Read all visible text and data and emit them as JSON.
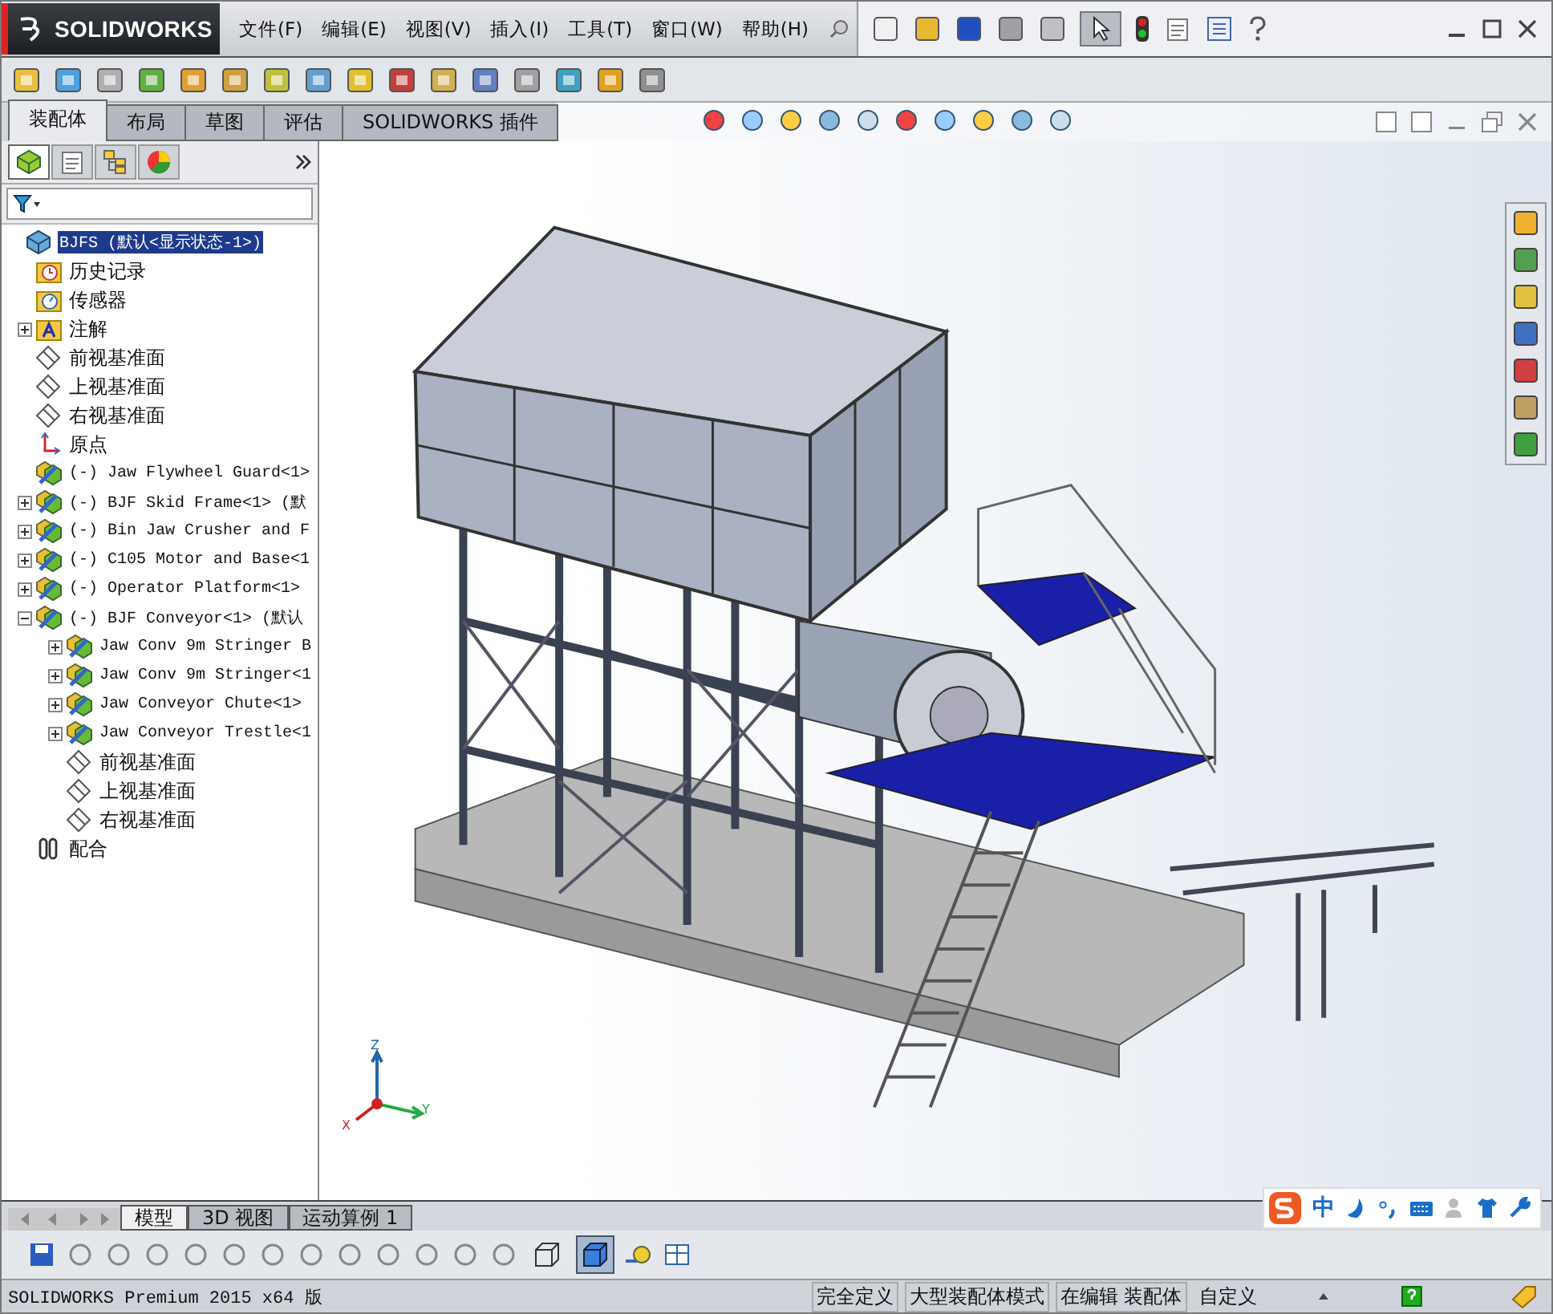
{
  "app": {
    "logo": "SOLIDWORKS"
  },
  "menu": [
    "文件(F)",
    "编辑(E)",
    "视图(V)",
    "插入(I)",
    "工具(T)",
    "窗口(W)",
    "帮助(H)"
  ],
  "select_tool": {
    "selected": true
  },
  "command_tabs": [
    {
      "label": "装配体",
      "selected": true
    },
    {
      "label": "布局",
      "selected": false
    },
    {
      "label": "草图",
      "selected": false
    },
    {
      "label": "评估",
      "selected": false
    },
    {
      "label": "SOLIDWORKS 插件",
      "selected": false
    }
  ],
  "panel_tabs": [
    {
      "kind": "features",
      "selected": true
    },
    {
      "kind": "properties",
      "selected": false
    },
    {
      "kind": "configurations",
      "selected": false
    },
    {
      "kind": "appearance",
      "selected": false
    }
  ],
  "feature_tree": [
    {
      "kind": "assembly",
      "label": "BJFS  (默认<显示状态-1>)",
      "selected": true,
      "children": [
        {
          "kind": "history",
          "label": "历史记录",
          "selected": false
        },
        {
          "kind": "sensor",
          "label": "传感器",
          "selected": false
        },
        {
          "kind": "annotation",
          "label": "注解",
          "selected": false,
          "expanded": false
        },
        {
          "kind": "plane",
          "label": "前视基准面",
          "selected": false
        },
        {
          "kind": "plane",
          "label": "上视基准面",
          "selected": false
        },
        {
          "kind": "plane",
          "label": "右视基准面",
          "selected": false
        },
        {
          "kind": "origin",
          "label": "原点",
          "selected": false
        },
        {
          "kind": "component",
          "label": "(-) Jaw Flywheel Guard<1>",
          "selected": false
        },
        {
          "kind": "component",
          "label": "(-) BJF Skid Frame<1> (默",
          "selected": false,
          "expanded": false
        },
        {
          "kind": "component",
          "label": "(-) Bin Jaw Crusher and F",
          "selected": false,
          "expanded": false
        },
        {
          "kind": "component",
          "label": "(-) C105 Motor and Base<1",
          "selected": false,
          "expanded": false
        },
        {
          "kind": "component",
          "label": "(-) Operator Platform<1>",
          "selected": false,
          "expanded": false
        },
        {
          "kind": "component",
          "label": "(-) BJF Conveyor<1> (默认",
          "selected": false,
          "expanded": true,
          "children": [
            {
              "kind": "component",
              "label": "Jaw Conv 9m Stringer B",
              "selected": false,
              "expanded": false
            },
            {
              "kind": "component",
              "label": "Jaw Conv 9m Stringer<1",
              "selected": false,
              "expanded": false
            },
            {
              "kind": "component",
              "label": "Jaw Conveyor Chute<1>",
              "selected": false,
              "expanded": false
            },
            {
              "kind": "component",
              "label": "Jaw Conveyor Trestle<1",
              "selected": false,
              "expanded": false
            },
            {
              "kind": "plane",
              "label": "前视基准面",
              "selected": false
            },
            {
              "kind": "plane",
              "label": "上视基准面",
              "selected": false
            },
            {
              "kind": "plane",
              "label": "右视基准面",
              "selected": false
            }
          ]
        },
        {
          "kind": "mate",
          "label": "配合",
          "selected": false
        }
      ]
    }
  ],
  "triad": {
    "z": "Z",
    "y": "Y",
    "x": "X"
  },
  "model_tabs": [
    {
      "label": "模型",
      "selected": true
    },
    {
      "label": "3D 视图",
      "selected": false
    },
    {
      "label": "运动算例 1",
      "selected": false
    }
  ],
  "view_buttons": [
    {
      "kind": "wireframe",
      "selected": false
    },
    {
      "kind": "shaded",
      "selected": true
    }
  ],
  "ime": {
    "mode": "中"
  },
  "status_bar": {
    "product": "SOLIDWORKS Premium 2015 x64 版",
    "fields": [
      "完全定义",
      "大型装配体模式",
      "在编辑 装配体"
    ],
    "units": "自定义"
  }
}
